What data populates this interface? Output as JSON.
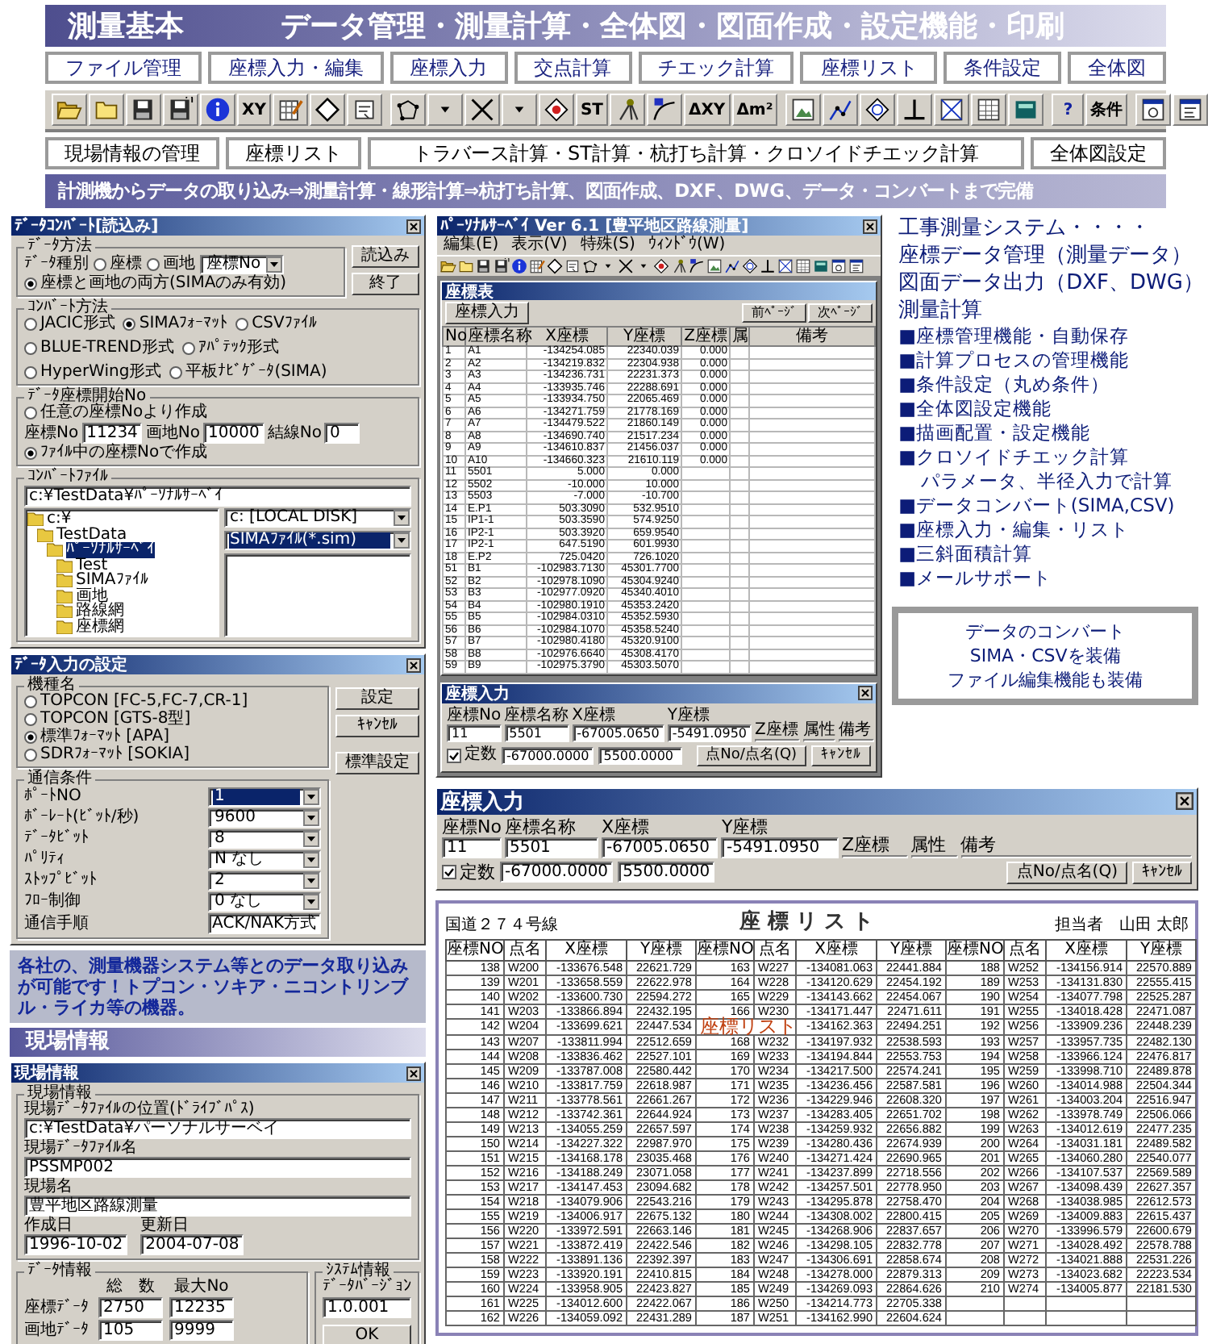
{
  "header": {
    "title": "測量基本",
    "subtitle": "データ管理・測量計算・全体図・図面作成・設定機能・印刷"
  },
  "function_tabs": [
    "ファイル管理",
    "座標入力・編集",
    "座標入力",
    "交点計算",
    "チエック計算",
    "座標リスト",
    "条件設定",
    "全体図"
  ],
  "toolbar": [
    [
      {
        "kind": "icon"
      },
      {
        "kind": "icon"
      },
      {
        "kind": "icon"
      },
      {
        "kind": "icon"
      },
      {
        "kind": "icon"
      },
      {
        "kind": "text",
        "label": "XY"
      },
      {
        "kind": "icon"
      },
      {
        "kind": "icon"
      },
      {
        "kind": "icon"
      }
    ],
    [
      {
        "kind": "icon"
      },
      {
        "kind": "icon"
      },
      {
        "kind": "icon"
      },
      {
        "kind": "icon"
      },
      {
        "kind": "icon"
      },
      {
        "kind": "text",
        "label": "ST"
      },
      {
        "kind": "icon"
      },
      {
        "kind": "icon"
      },
      {
        "kind": "text",
        "label": "ΔXY"
      },
      {
        "kind": "text",
        "label": "Δm²"
      }
    ],
    [
      {
        "kind": "icon"
      },
      {
        "kind": "icon"
      },
      {
        "kind": "icon"
      },
      {
        "kind": "icon"
      },
      {
        "kind": "icon"
      },
      {
        "kind": "icon"
      },
      {
        "kind": "icon"
      }
    ],
    [
      {
        "kind": "text",
        "label": "?"
      },
      {
        "kind": "text",
        "label": "条件"
      }
    ],
    [
      {
        "kind": "icon"
      },
      {
        "kind": "icon"
      }
    ]
  ],
  "feature_buttons": [
    "現場情報の管理",
    "座標リスト",
    "トラバース計算・ST計算・杭打ち計算・クロソイドチエック計算",
    "全体図設定"
  ],
  "banner": "計測機からデータの取り込み⇒測量計算・線形計算⇒杭打ち計算、図面作成、DXF、DWG、データ・コンバートまで完備",
  "convert_dialog": {
    "title": "ﾃﾞｰﾀｺﾝﾊﾞｰﾄ[読込み]",
    "buttons": [
      "読込み",
      "終了"
    ],
    "data_method": {
      "label": "ﾃﾞｰﾀ方法",
      "type_label": "ﾃﾞｰﾀ種別",
      "options": [
        {
          "label": "座標",
          "selected": false
        },
        {
          "label": "画地",
          "selected": false
        },
        {
          "label": "座標と画地の両方(SIMAのみ有効)",
          "selected": true
        }
      ],
      "select": "座標No"
    },
    "convert_method": {
      "label": "ｺﾝﾊﾞｰﾄ方法",
      "options": [
        {
          "label": "JACIC形式",
          "selected": false
        },
        {
          "label": "SIMAﾌｫｰﾏｯﾄ",
          "selected": true
        },
        {
          "label": "CSVﾌｧｲﾙ",
          "selected": false
        },
        {
          "label": "BLUE-TREND形式",
          "selected": false
        },
        {
          "label": "ｱﾊﾟﾃｯｸ形式",
          "selected": false
        },
        {
          "label": "HyperWing形式",
          "selected": false
        },
        {
          "label": "平板ﾅﾋﾞｹﾞｰﾀ(SIMA)",
          "selected": false
        }
      ]
    },
    "start_no": {
      "label": "ﾃﾞｰﾀ座標開始No",
      "options": [
        {
          "label": "任意の座標Noより作成",
          "selected": false
        },
        {
          "label": "ﾌｧｲﾙ中の座標Noで作成",
          "selected": true
        }
      ],
      "fields": [
        {
          "label": "座標No",
          "value": "11234"
        },
        {
          "label": "画地No",
          "value": "10000"
        },
        {
          "label": "結線No",
          "value": "0"
        }
      ]
    },
    "file": {
      "label": "ｺﾝﾊﾞｰﾄﾌｧｲﾙ",
      "path": "c:¥TestData¥ﾊﾟｰｿﾅﾙｻｰﾍﾞｲ",
      "drive": "c: [LOCAL DISK]",
      "filter": "SIMAﾌｧｲﾙ(*.sim)",
      "folders": [
        {
          "name": "c:¥",
          "selected": false,
          "children": [
            {
              "name": "TestData",
              "selected": false,
              "children": [
                {
                  "name": "ﾊﾟｰｿﾅﾙｻｰﾍﾞｲ",
                  "selected": true,
                  "children": [
                    {
                      "name": "Test",
                      "selected": false
                    },
                    {
                      "name": "SIMAﾌｧｲﾙ",
                      "selected": false
                    },
                    {
                      "name": "画地",
                      "selected": false
                    },
                    {
                      "name": "路線網",
                      "selected": false
                    },
                    {
                      "name": "座標網",
                      "selected": false
                    }
                  ]
                }
              ]
            }
          ]
        }
      ]
    }
  },
  "settings_dialog": {
    "title": "ﾃﾞｰﾀ入力の設定",
    "model_label": "機種名",
    "models": [
      {
        "label": "TOPCON [FC-5,FC-7,CR-1]",
        "selected": false
      },
      {
        "label": "TOPCON [GTS-8型]",
        "selected": false
      },
      {
        "label": "標準ﾌｫｰﾏｯﾄ [APA]",
        "selected": true
      },
      {
        "label": "SDRﾌｫｰﾏｯﾄ [SOKIA]",
        "selected": false
      }
    ],
    "buttons": [
      "設定",
      "ｷｬﾝｾﾙ",
      "標準設定"
    ],
    "comm_label": "通信条件",
    "settings": [
      {
        "label": "ﾎﾟｰﾄNO",
        "value": "1",
        "kind": "select",
        "focused": true
      },
      {
        "label": "ﾎﾞｰﾚｰﾄ(ﾋﾞｯﾄ/秒)",
        "value": "9600",
        "kind": "select",
        "focused": false
      },
      {
        "label": "ﾃﾞｰﾀﾋﾞｯﾄ",
        "value": "8",
        "kind": "select",
        "focused": false
      },
      {
        "label": "ﾊﾟﾘﾃｨ",
        "value": "N なし",
        "kind": "select",
        "focused": false
      },
      {
        "label": "ｽﾄｯﾌﾟﾋﾞｯﾄ",
        "value": "2",
        "kind": "select",
        "focused": false
      },
      {
        "label": "ﾌﾛｰ制御",
        "value": "0 なし",
        "kind": "select",
        "focused": false
      },
      {
        "label": "通信手順",
        "value": "ACK/NAK方式",
        "kind": "text",
        "focused": false
      }
    ]
  },
  "main_window": {
    "title": "ﾊﾟｰｿﾅﾙｻｰﾍﾞｲ Ver 6.1 [豊平地区路線測量]",
    "menu": [
      "編集(E)",
      "表示(V)",
      "特殊(S)",
      "ｳｨﾝﾄﾞｳ(W)"
    ],
    "child_title": "座標表",
    "add_button": "座標入力",
    "page_buttons": [
      "前ﾍﾟｰｼﾞ",
      "次ﾍﾟｰｼﾞ"
    ],
    "columns": [
      "No",
      "座標名称",
      "X座標",
      "Y座標",
      "Z座標",
      "属",
      "備考"
    ],
    "rows": [
      [
        "1",
        "A1",
        "-134254.085",
        "22340.039",
        "0.000"
      ],
      [
        "2",
        "A2",
        "-134219.832",
        "22304.938",
        "0.000"
      ],
      [
        "3",
        "A3",
        "-134236.731",
        "22231.373",
        "0.000"
      ],
      [
        "4",
        "A4",
        "-133935.746",
        "22288.691",
        "0.000"
      ],
      [
        "5",
        "A5",
        "-133934.750",
        "22065.469",
        "0.000"
      ],
      [
        "6",
        "A6",
        "-134271.759",
        "21778.169",
        "0.000"
      ],
      [
        "7",
        "A7",
        "-134479.522",
        "21860.149",
        "0.000"
      ],
      [
        "8",
        "A8",
        "-134690.740",
        "21517.234",
        "0.000"
      ],
      [
        "9",
        "A9",
        "-134610.837",
        "21456.037",
        "0.000"
      ],
      [
        "10",
        "A10",
        "-134660.323",
        "21610.119",
        "0.000"
      ],
      [
        "11",
        "5501",
        "5.000",
        "0.000"
      ],
      [
        "12",
        "5502",
        "-10.000",
        "10.000"
      ],
      [
        "13",
        "5503",
        "-7.000",
        "-10.700"
      ],
      [
        "14",
        "E.P1",
        "503.3090",
        "532.9510"
      ],
      [
        "15",
        "IP1-1",
        "503.3590",
        "574.9250"
      ],
      [
        "16",
        "IP2-1",
        "503.3920",
        "659.9540"
      ],
      [
        "17",
        "IP2-1",
        "647.5190",
        "601.9930"
      ],
      [
        "18",
        "E.P2",
        "725.0420",
        "726.1020"
      ],
      [
        "51",
        "B1",
        "-102983.7130",
        "45301.7700"
      ],
      [
        "52",
        "B2",
        "-102978.1090",
        "45304.9240"
      ],
      [
        "53",
        "B3",
        "-102977.0920",
        "45340.4010"
      ],
      [
        "54",
        "B4",
        "-102980.1910",
        "45353.2420"
      ],
      [
        "55",
        "B5",
        "-102984.0310",
        "45352.5930"
      ],
      [
        "56",
        "B6",
        "-102984.1070",
        "45358.5240"
      ],
      [
        "57",
        "B7",
        "-102980.4180",
        "45320.9100"
      ],
      [
        "58",
        "B8",
        "-102976.6640",
        "45308.4170"
      ],
      [
        "59",
        "B9",
        "-102975.3790",
        "45303.5070"
      ]
    ]
  },
  "coord_popup": {
    "title": "座標入力",
    "columns": [
      "座標No",
      "座標名称",
      "X座標",
      "Y座標",
      "Z座標",
      "属性",
      "備考"
    ],
    "values": [
      "11",
      "5501",
      "-67005.0650",
      "-5491.0950"
    ],
    "constant": {
      "label": "定数",
      "checked": true
    },
    "constant_values": [
      "-67000.0000",
      "5500.0000"
    ],
    "buttons": [
      "点No/点名(Q)",
      "ｷｬﾝｾﾙ"
    ]
  },
  "coord_panel": {
    "title": "座標入力",
    "columns": [
      "座標No",
      "座標名称",
      "X座標",
      "Y座標",
      "Z座標",
      "属性",
      "備考"
    ],
    "values": [
      "11",
      "5501",
      "-67005.0650",
      "-5491.0950"
    ],
    "constant": {
      "label": "定数",
      "checked": true
    },
    "constant_values": [
      "-67000.0000",
      "5500.0000"
    ],
    "buttons": [
      "点No/点名(Q)",
      "ｷｬﾝｾﾙ"
    ]
  },
  "features": {
    "intro": [
      "工事測量システム・・・・",
      "座標データ管理（測量データ）",
      "図面データ出力（DXF、DWG）",
      "測量計算"
    ],
    "items": [
      {
        "kind": "bullet",
        "text": "■座標管理機能・自動保存"
      },
      {
        "kind": "bullet",
        "text": "■計算プロセスの管理機能"
      },
      {
        "kind": "bullet",
        "text": "■条件設定（丸め条件）"
      },
      {
        "kind": "bullet",
        "text": "■全体図設定機能"
      },
      {
        "kind": "bullet",
        "text": "■描画配置・設定機能"
      },
      {
        "kind": "bullet",
        "text": "■クロソイドチエック計算"
      },
      {
        "kind": "sub",
        "text": "パラメータ、半径入力で計算"
      },
      {
        "kind": "bullet",
        "text": "■データコンバート(SIMA,CSV)"
      },
      {
        "kind": "bullet",
        "text": "■座標入力・編集・リスト"
      },
      {
        "kind": "bullet",
        "text": "■三斜面積計算"
      },
      {
        "kind": "bullet",
        "text": "■メールサポート"
      }
    ]
  },
  "convert_box": [
    "データのコンバート",
    "SIMA・CSVを装備",
    "ファイル編集機能も装備"
  ],
  "compat_text": "各社の、測量機器システム等とのデータ取り込みが可能です！トプコン・ソキア・ニコントリンブル・ライカ等の機器。",
  "site_banner": "現場情報",
  "site_dialog": {
    "title": "現場情報",
    "group": "現場情報",
    "fields": [
      {
        "label": "現場ﾃﾞｰﾀﾌｧｲﾙの位置(ﾄﾞﾗｲﾌﾞﾊﾟｽ)",
        "value": "c:¥TestData¥パーソナルサーベイ"
      },
      {
        "label": "現場ﾃﾞｰﾀﾌｧｲﾙ名",
        "value": "PSSMP002"
      },
      {
        "label": "現場名",
        "value": "豊平地区路線測量"
      }
    ],
    "dates": [
      {
        "label": "作成日",
        "value": "1996-10-02"
      },
      {
        "label": "更新日",
        "value": "2004-07-08"
      }
    ],
    "data_group": "ﾃﾞｰﾀ情報",
    "data_columns": [
      "総　数",
      "最大No"
    ],
    "data_rows": [
      {
        "label": "座標ﾃﾞｰﾀ",
        "values": [
          "2750",
          "12235"
        ]
      },
      {
        "label": "画地ﾃﾞｰﾀ",
        "values": [
          "105",
          "9999"
        ]
      }
    ],
    "system_group": "ｼｽﾃﾑ情報",
    "version_label": "ﾃﾞｰﾀﾊﾞｰｼﾞｮﾝ",
    "version": "1.0.001",
    "ok": "OK"
  },
  "coord_list": {
    "route": "国道２７４号線",
    "title": "座 標 リ ス ト",
    "person": "担当者　山田 太郎",
    "caption": "座標リスト",
    "columns": [
      "座標NO",
      "点名",
      "X座標",
      "Y座標",
      "座標NO",
      "点名",
      "X座標",
      "Y座標",
      "座標NO",
      "点名",
      "X座標",
      "Y座標"
    ],
    "rows": [
      [
        "138",
        "W200",
        "-133676.548",
        "22621.729",
        "163",
        "W227",
        "-134081.063",
        "22441.884",
        "188",
        "W252",
        "-134156.914",
        "22570.889"
      ],
      [
        "139",
        "W201",
        "-133658.559",
        "22622.978",
        "164",
        "W228",
        "-134120.629",
        "22454.192",
        "189",
        "W253",
        "-134131.830",
        "22555.415"
      ],
      [
        "140",
        "W202",
        "-133600.730",
        "22594.272",
        "165",
        "W229",
        "-134143.662",
        "22454.067",
        "190",
        "W254",
        "-134077.798",
        "22525.287"
      ],
      [
        "141",
        "W203",
        "-133866.894",
        "22432.195",
        "166",
        "W230",
        "-134171.447",
        "22471.611",
        "191",
        "W255",
        "-134018.428",
        "22471.087"
      ],
      [
        "142",
        "W204",
        "-133699.621",
        "22447.534",
        null,
        null,
        "-134162.363",
        "22494.251",
        "192",
        "W256",
        "-133909.236",
        "22448.239"
      ],
      [
        "143",
        "W207",
        "-133811.994",
        "22512.659",
        "168",
        "W232",
        "-134197.932",
        "22538.593",
        "193",
        "W257",
        "-133957.735",
        "22482.130"
      ],
      [
        "144",
        "W208",
        "-133836.462",
        "22527.101",
        "169",
        "W233",
        "-134194.844",
        "22553.753",
        "194",
        "W258",
        "-133966.124",
        "22476.817"
      ],
      [
        "145",
        "W209",
        "-133787.008",
        "22580.442",
        "170",
        "W234",
        "-134217.500",
        "22574.241",
        "195",
        "W259",
        "-133998.710",
        "22489.878"
      ],
      [
        "146",
        "W210",
        "-133817.759",
        "22618.987",
        "171",
        "W235",
        "-134236.456",
        "22587.581",
        "196",
        "W260",
        "-134014.988",
        "22504.344"
      ],
      [
        "147",
        "W211",
        "-133778.561",
        "22661.267",
        "172",
        "W236",
        "-134229.946",
        "22608.320",
        "197",
        "W261",
        "-134003.204",
        "22516.947"
      ],
      [
        "148",
        "W212",
        "-133742.361",
        "22644.924",
        "173",
        "W237",
        "-134283.405",
        "22651.702",
        "198",
        "W262",
        "-133978.749",
        "22506.066"
      ],
      [
        "149",
        "W213",
        "-134055.259",
        "22657.597",
        "174",
        "W238",
        "-134259.932",
        "22656.882",
        "199",
        "W263",
        "-134012.619",
        "22477.235"
      ],
      [
        "150",
        "W214",
        "-134227.322",
        "22987.970",
        "175",
        "W239",
        "-134280.436",
        "22674.939",
        "200",
        "W264",
        "-134031.181",
        "22489.582"
      ],
      [
        "151",
        "W215",
        "-134168.178",
        "23035.468",
        "176",
        "W240",
        "-134271.424",
        "22690.965",
        "201",
        "W265",
        "-134060.280",
        "22540.077"
      ],
      [
        "152",
        "W216",
        "-134188.249",
        "23071.058",
        "177",
        "W241",
        "-134237.899",
        "22718.556",
        "202",
        "W266",
        "-134107.537",
        "22569.589"
      ],
      [
        "153",
        "W217",
        "-134147.453",
        "23094.682",
        "178",
        "W242",
        "-134257.501",
        "22778.950",
        "203",
        "W267",
        "-134098.439",
        "22627.357"
      ],
      [
        "154",
        "W218",
        "-134079.906",
        "22543.216",
        "179",
        "W243",
        "-134295.878",
        "22758.470",
        "204",
        "W268",
        "-134038.985",
        "22612.573"
      ],
      [
        "155",
        "W219",
        "-134006.917",
        "22675.132",
        "180",
        "W244",
        "-134308.002",
        "22800.415",
        "205",
        "W269",
        "-134009.883",
        "22615.437"
      ],
      [
        "156",
        "W220",
        "-133972.591",
        "22663.146",
        "181",
        "W245",
        "-134268.906",
        "22837.657",
        "206",
        "W270",
        "-133996.579",
        "22600.679"
      ],
      [
        "157",
        "W221",
        "-133872.419",
        "22422.546",
        "182",
        "W246",
        "-134298.105",
        "22832.778",
        "207",
        "W271",
        "-134028.492",
        "22578.788"
      ],
      [
        "158",
        "W222",
        "-133891.136",
        "22392.397",
        "183",
        "W247",
        "-134306.691",
        "22858.674",
        "208",
        "W272",
        "-134021.888",
        "22531.226"
      ],
      [
        "159",
        "W223",
        "-133920.191",
        "22410.815",
        "184",
        "W248",
        "-134278.000",
        "22879.313",
        "209",
        "W273",
        "-134023.682",
        "22223.534"
      ],
      [
        "160",
        "W224",
        "-133958.905",
        "22423.827",
        "185",
        "W249",
        "-134269.093",
        "22864.626",
        "210",
        "W274",
        "-134005.877",
        "22181.530"
      ],
      [
        "161",
        "W225",
        "-134012.600",
        "22422.067",
        "186",
        "W250",
        "-134214.773",
        "22705.338",
        null,
        null,
        null,
        null
      ],
      [
        "162",
        "W226",
        "-134059.092",
        "22431.289",
        "187",
        "W251",
        "-134162.990",
        "22604.624",
        null,
        null,
        null,
        null
      ]
    ]
  }
}
